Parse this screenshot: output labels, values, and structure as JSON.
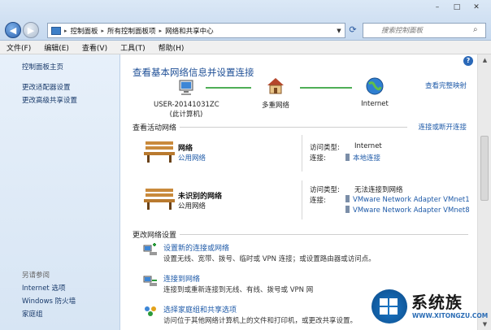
{
  "window": {
    "min_glyph": "–",
    "max_glyph": "□",
    "close_glyph": "✕"
  },
  "address": {
    "breadcrumbs": [
      "控制面板",
      "所有控制面板项",
      "网络和共享中心"
    ],
    "search_placeholder": "搜索控制面板"
  },
  "menu": [
    "文件(F)",
    "编辑(E)",
    "查看(V)",
    "工具(T)",
    "帮助(H)"
  ],
  "sidebar": {
    "links": [
      "控制面板主页",
      "更改适配器设置",
      "更改高级共享设置"
    ],
    "see_also_title": "另请参阅",
    "see_also": [
      "Internet 选项",
      "Windows 防火墙",
      "家庭组"
    ]
  },
  "main": {
    "heading": "查看基本网络信息并设置连接",
    "full_map": "查看完整映射",
    "map": {
      "computer_name": "USER-20141031ZC",
      "computer_sub": "(此计算机)",
      "middle": "多重网络",
      "internet": "Internet"
    },
    "active_title": "查看活动网络",
    "active_link": "连接或断开连接",
    "networks": [
      {
        "name": "网络",
        "type": "公用网络",
        "access_label": "访问类型:",
        "access_value": "Internet",
        "conn_label": "连接:",
        "connections": [
          "本地连接"
        ]
      },
      {
        "name": "未识别的网络",
        "type": "公用网络",
        "access_label": "访问类型:",
        "access_value": "无法连接到网络",
        "conn_label": "连接:",
        "connections": [
          "VMware Network Adapter VMnet1",
          "VMware Network Adapter VMnet8"
        ]
      }
    ],
    "change_title": "更改网络设置",
    "tasks": [
      {
        "title": "设置新的连接或网络",
        "desc": "设置无线、宽带、拨号、临时或 VPN 连接；或设置路由器或访问点。"
      },
      {
        "title": "连接到网络",
        "desc": "连接到或重新连接到无线、有线、拨号或 VPN 网"
      },
      {
        "title": "选择家庭组和共享选项",
        "desc": "访问位于其他网络计算机上的文件和打印机，或更改共享设置。"
      }
    ]
  },
  "watermark": {
    "text": "系统族",
    "url": "WWW.XITONGZU.COM"
  }
}
